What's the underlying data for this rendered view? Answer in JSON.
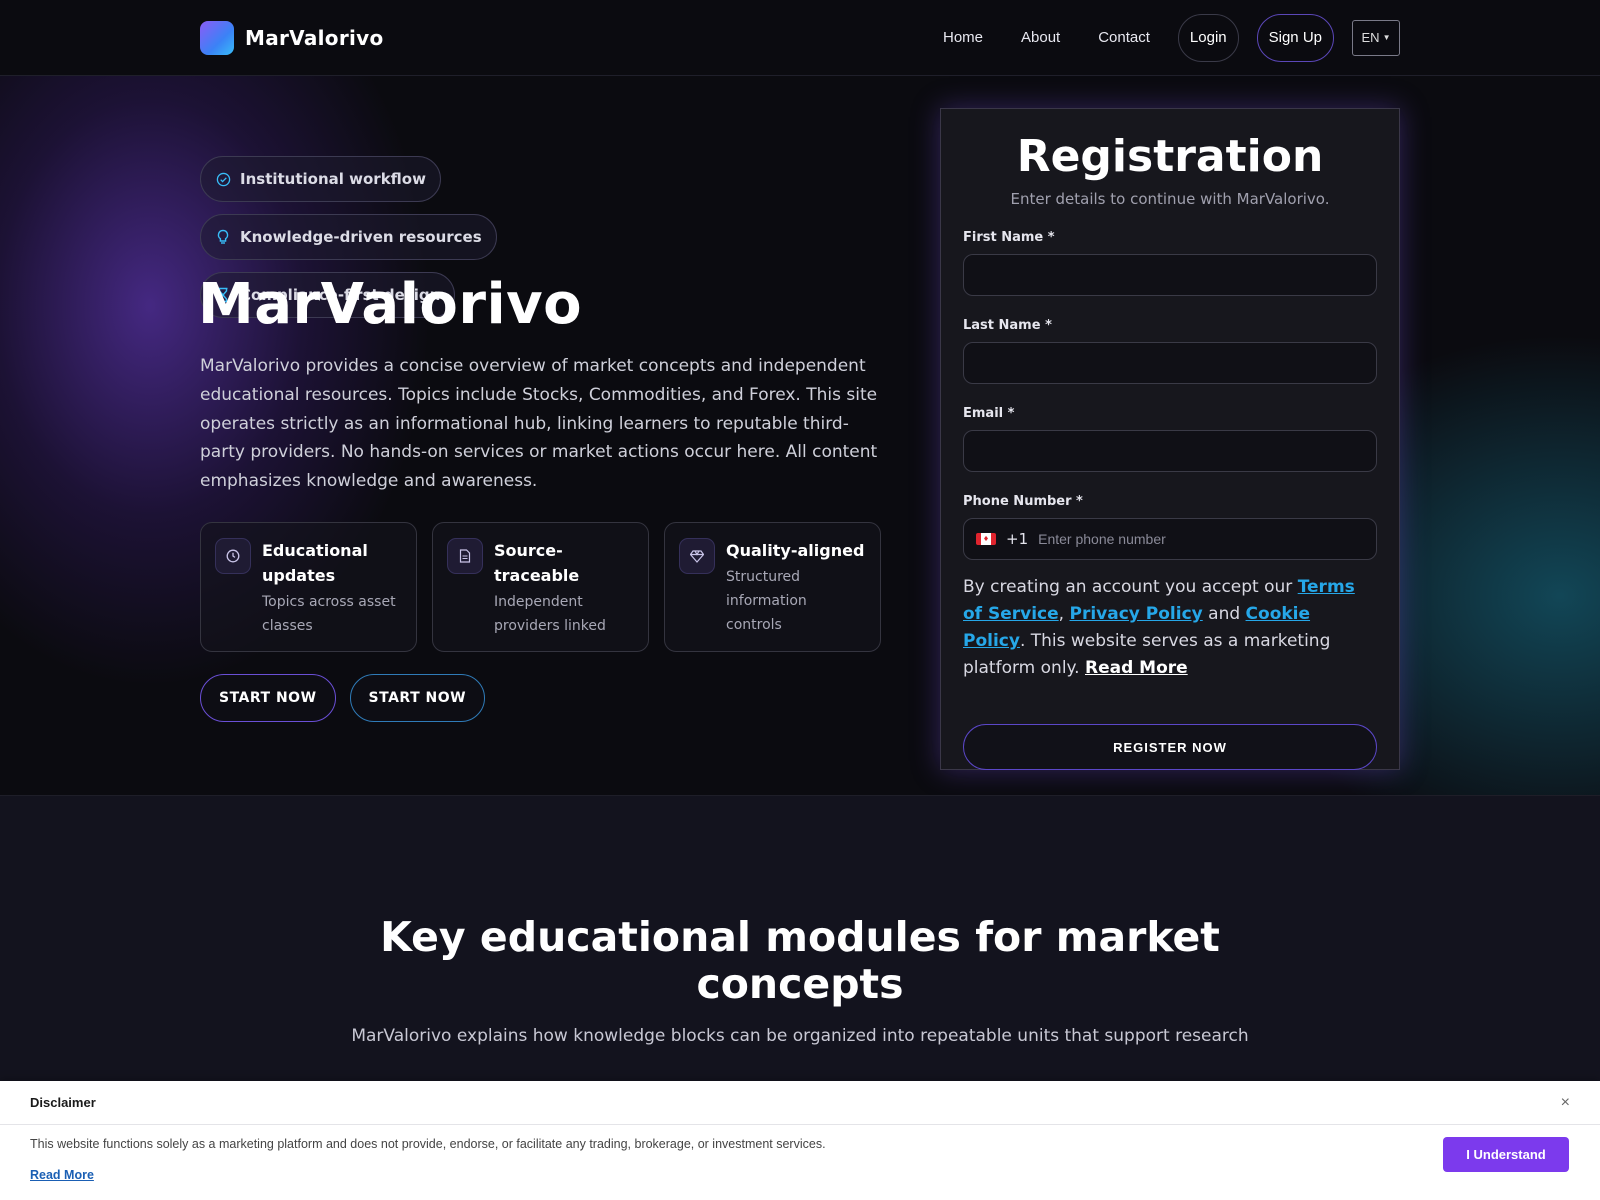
{
  "header": {
    "brand": "MarValorivo",
    "nav": [
      "Home",
      "About",
      "Contact"
    ],
    "login": "Login",
    "signup": "Sign Up",
    "lang": "EN"
  },
  "hero": {
    "badges": [
      {
        "icon": "check-circle-icon",
        "label": "Institutional workflow"
      },
      {
        "icon": "lightbulb-icon",
        "label": "Knowledge-driven resources"
      },
      {
        "icon": "hourglass-icon",
        "label": "Compliance-first design"
      }
    ],
    "title": "MarValorivo",
    "description": "MarValorivo provides a concise overview of market concepts and independent educational resources. Topics include Stocks, Commodities, and Forex. This site operates strictly as an informational hub, linking learners to reputable third-party providers. No hands-on services or market actions occur here. All content emphasizes knowledge and awareness.",
    "features": [
      {
        "icon": "clock-icon",
        "title": "Educational updates",
        "subtitle": "Topics across asset classes"
      },
      {
        "icon": "document-icon",
        "title": "Source-traceable",
        "subtitle": "Independent providers linked"
      },
      {
        "icon": "diamond-icon",
        "title": "Quality-aligned",
        "subtitle": "Structured information controls"
      }
    ],
    "cta_primary": "START NOW",
    "cta_secondary": "START NOW"
  },
  "registration": {
    "title": "Registration",
    "subtitle": "Enter details to continue with MarValorivo.",
    "first_name_label": "First Name *",
    "last_name_label": "Last Name *",
    "email_label": "Email *",
    "phone_label": "Phone Number *",
    "dial_code": "+1",
    "phone_placeholder": "Enter phone number",
    "terms_prefix": "By creating an account you accept our ",
    "terms_link": "Terms of Service",
    "comma": ",",
    "privacy_link": "Privacy Policy",
    "and": " and ",
    "cookie_link": "Cookie Policy",
    "terms_suffix": ". This website serves as a marketing platform only. ",
    "read_more": "Read More",
    "button": "REGISTER NOW"
  },
  "modules": {
    "title": "Key educational modules for market concepts",
    "subtitle": "MarValorivo explains how knowledge blocks can be organized into repeatable units that support research"
  },
  "disclaimer": {
    "title": "Disclaimer",
    "close": "×",
    "text": "This website functions solely as a marketing platform and does not provide, endorse, or facilitate any trading, brokerage, or investment services.",
    "read_more": "Read More",
    "button": "I Understand"
  },
  "colors": {
    "accent": "#7c3aed",
    "link": "#26a7e8",
    "background": "#0b0b10"
  }
}
